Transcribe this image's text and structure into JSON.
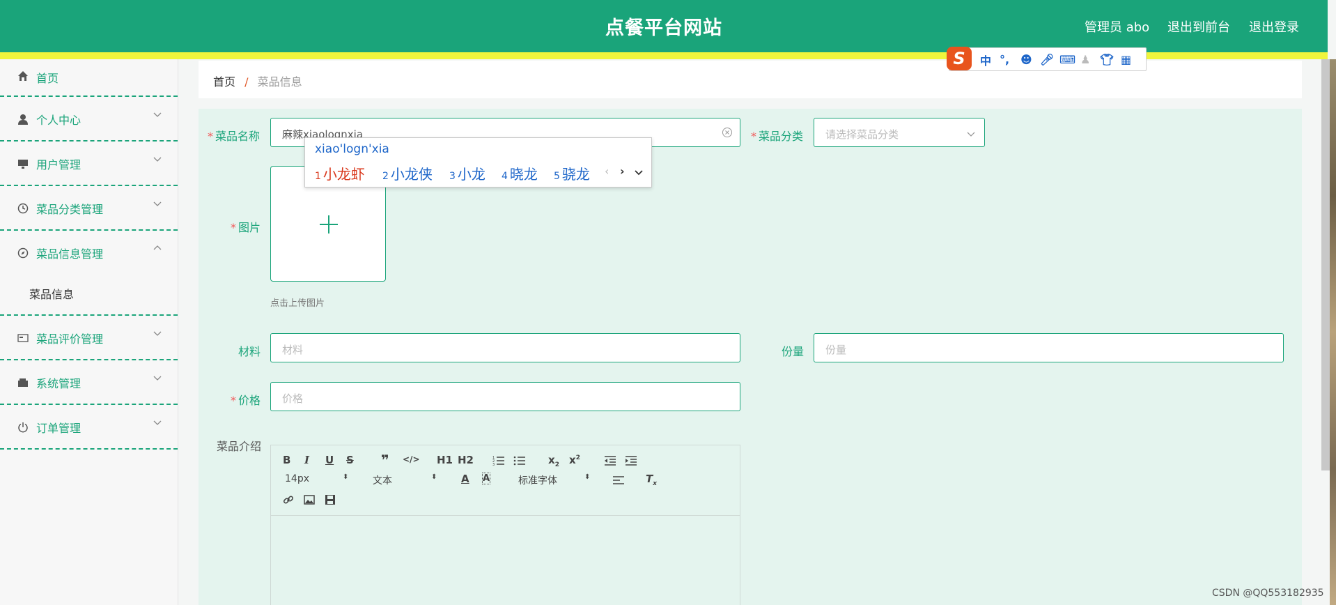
{
  "header": {
    "title": "点餐平台网站",
    "admin": "管理员 abo",
    "to_front": "退出到前台",
    "logout": "退出登录"
  },
  "sidebar": {
    "items": [
      {
        "label": "首页",
        "icon": "home-icon"
      },
      {
        "label": "个人中心",
        "icon": "user-icon"
      },
      {
        "label": "用户管理",
        "icon": "monitor-icon"
      },
      {
        "label": "菜品分类管理",
        "icon": "clock-icon"
      },
      {
        "label": "菜品信息管理",
        "icon": "compass-icon",
        "expanded": true
      },
      {
        "label": "菜品评价管理",
        "icon": "card-icon"
      },
      {
        "label": "系统管理",
        "icon": "wallet-icon"
      },
      {
        "label": "订单管理",
        "icon": "power-icon"
      }
    ],
    "sub_item": "菜品信息"
  },
  "breadcrumb": {
    "home": "首页",
    "sep": "/",
    "current": "菜品信息"
  },
  "form": {
    "name_label": "菜品名称",
    "name_value": "麻辣xiaolognxia",
    "category_label": "菜品分类",
    "category_placeholder": "请选择菜品分类",
    "image_label": "图片",
    "upload_tip": "点击上传图片",
    "material_label": "材料",
    "material_placeholder": "材料",
    "portion_label": "份量",
    "portion_placeholder": "份量",
    "price_label": "价格",
    "price_placeholder": "价格",
    "intro_label": "菜品介绍"
  },
  "editor": {
    "font_size": "14px",
    "text_style": "文本",
    "font_family": "标准字体",
    "h1": "H1",
    "h2": "H2"
  },
  "ime": {
    "mode": "中",
    "pinyin": "xiao'logn'xia",
    "candidates": [
      {
        "n": "1",
        "text": "小龙虾"
      },
      {
        "n": "2",
        "text": "小龙侠"
      },
      {
        "n": "3",
        "text": "小龙"
      },
      {
        "n": "4",
        "text": "晓龙"
      },
      {
        "n": "5",
        "text": "骁龙"
      }
    ]
  },
  "watermark": "CSDN @QQ553182935",
  "colors": {
    "primary": "#1aa47a",
    "accent_strip": "#f0f53c",
    "required": "#f15959",
    "form_bg": "#e4f4ee"
  }
}
